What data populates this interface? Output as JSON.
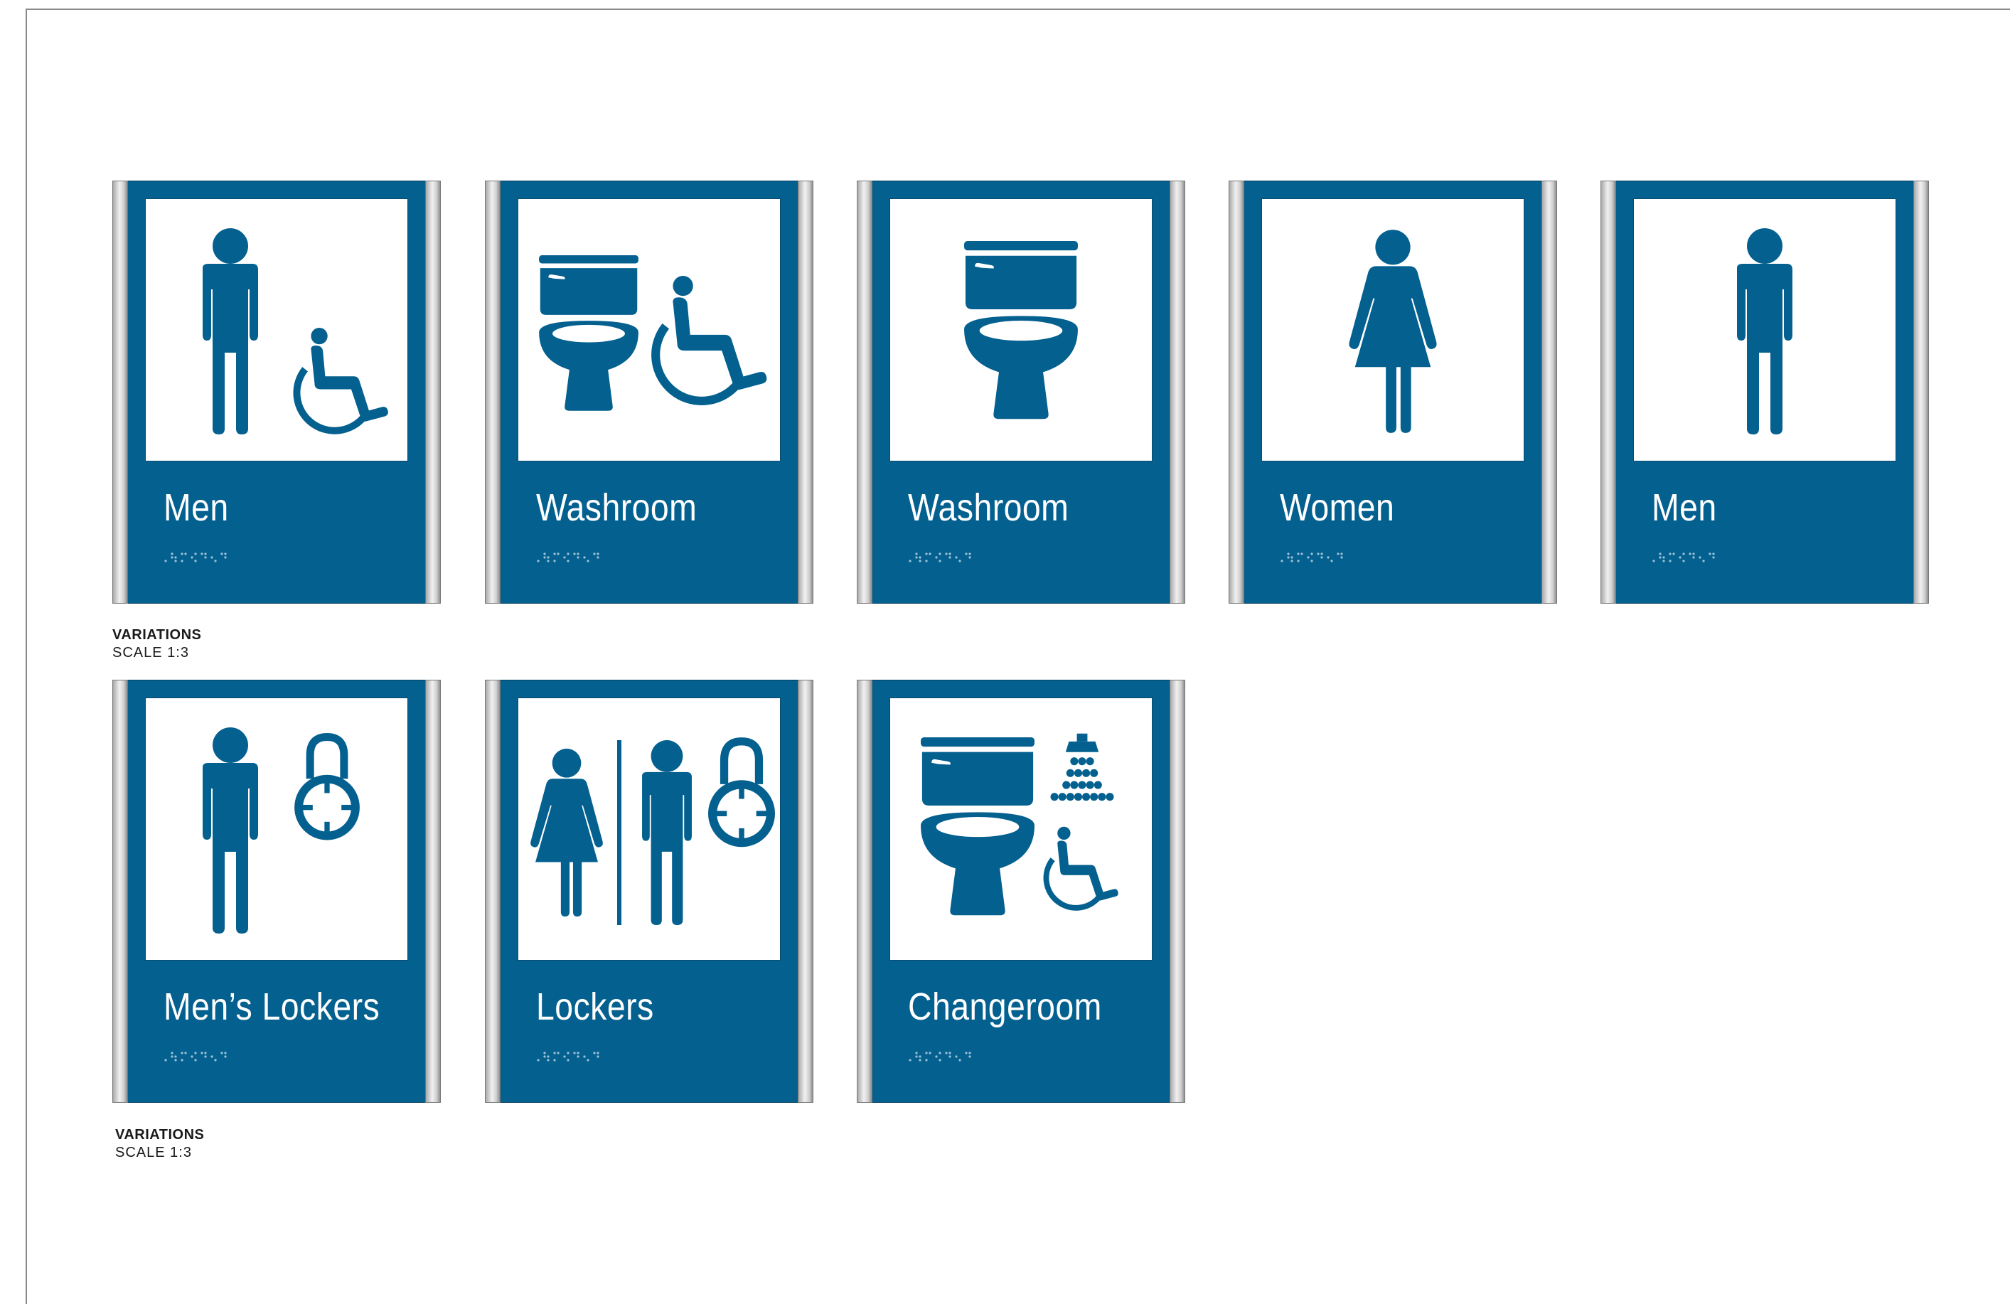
{
  "colors": {
    "sign_blue": "#04608f",
    "window_white": "#ffffff",
    "post_metal": "#d0d0d0"
  },
  "signs": [
    {
      "label": "Men",
      "icons": [
        "man-icon",
        "wheelchair-icon"
      ]
    },
    {
      "label": "Washroom",
      "icons": [
        "toilet-icon",
        "wheelchair-icon"
      ]
    },
    {
      "label": "Washroom",
      "icons": [
        "toilet-icon"
      ]
    },
    {
      "label": "Women",
      "icons": [
        "woman-icon"
      ]
    },
    {
      "label": "Men",
      "icons": [
        "man-icon"
      ]
    },
    {
      "label": "Men’s Lockers",
      "icons": [
        "man-icon",
        "padlock-icon"
      ]
    },
    {
      "label": "Lockers",
      "icons": [
        "woman-icon",
        "man-icon",
        "padlock-icon"
      ]
    },
    {
      "label": "Changeroom",
      "icons": [
        "toilet-icon",
        "shower-icon",
        "wheelchair-icon"
      ]
    }
  ],
  "captions": [
    {
      "title": "VARIATIONS",
      "scale": "SCALE 1:3"
    },
    {
      "title": "VARIATIONS",
      "scale": "SCALE 1:3"
    }
  ]
}
